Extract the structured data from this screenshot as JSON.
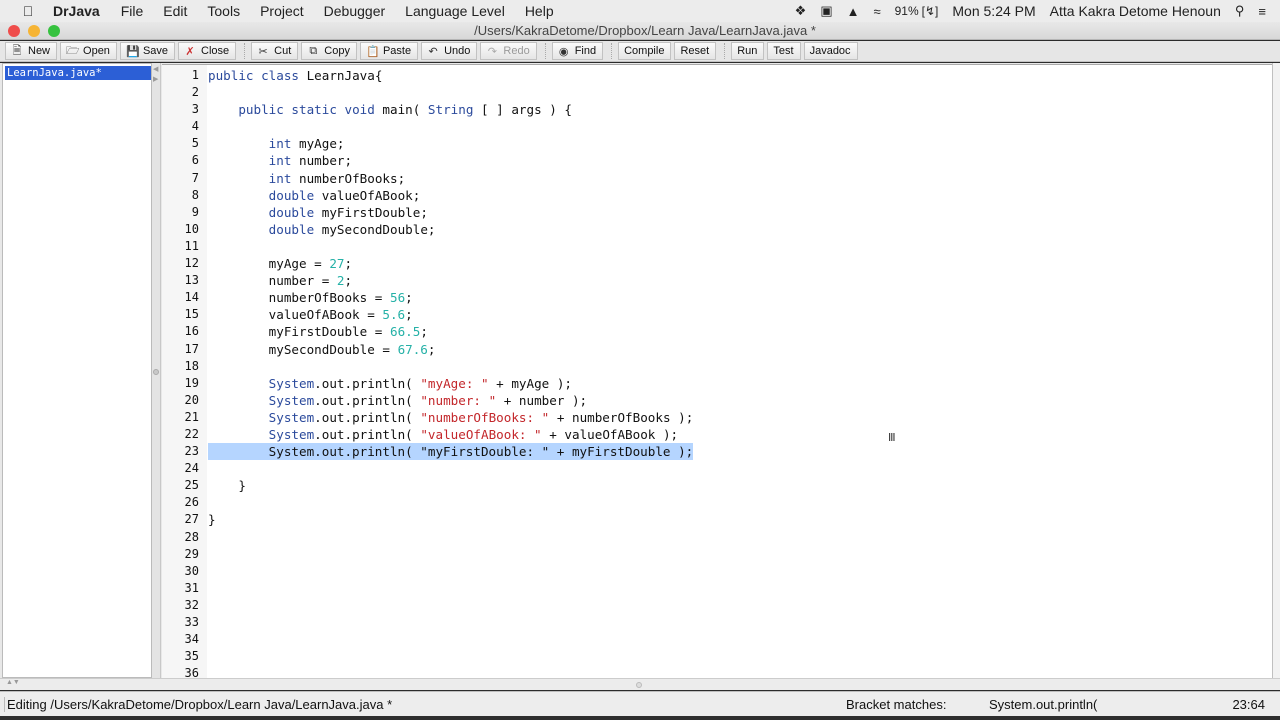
{
  "menubar": {
    "app_name": "DrJava",
    "menus": [
      "File",
      "Edit",
      "Tools",
      "Project",
      "Debugger",
      "Language Level",
      "Help"
    ],
    "status": {
      "battery": "91%",
      "clock": "Mon 5:24 PM",
      "user": "Atta Kakra Detome Henoun"
    }
  },
  "window": {
    "title": "/Users/KakraDetome/Dropbox/Learn Java/LearnJava.java *"
  },
  "toolbar": {
    "buttons": [
      {
        "label": "New",
        "icon": "new-file-icon"
      },
      {
        "label": "Open",
        "icon": "folder-icon"
      },
      {
        "label": "Save",
        "icon": "floppy-icon"
      },
      {
        "label": "Close",
        "icon": "close-file-icon"
      },
      {
        "label": "Cut",
        "icon": "scissors-icon"
      },
      {
        "label": "Copy",
        "icon": "copy-icon"
      },
      {
        "label": "Paste",
        "icon": "clipboard-icon"
      },
      {
        "label": "Undo",
        "icon": "undo-icon"
      },
      {
        "label": "Redo",
        "icon": "redo-icon",
        "disabled": true
      },
      {
        "label": "Find",
        "icon": "binoculars-icon"
      },
      {
        "label": "Compile"
      },
      {
        "label": "Reset"
      },
      {
        "label": "Run"
      },
      {
        "label": "Test"
      },
      {
        "label": "Javadoc"
      }
    ]
  },
  "sidebar": {
    "files": [
      {
        "name": "LearnJava.java*",
        "selected": true
      }
    ]
  },
  "editor": {
    "selected_line": 23,
    "lines": [
      [
        {
          "t": "kw",
          "v": "public class "
        },
        {
          "t": "",
          "v": "LearnJava{"
        }
      ],
      [],
      [
        {
          "t": "",
          "v": "    "
        },
        {
          "t": "kw",
          "v": "public static void "
        },
        {
          "t": "",
          "v": "main( "
        },
        {
          "t": "kw",
          "v": "String"
        },
        {
          "t": "",
          "v": " [ ] args ) {"
        }
      ],
      [],
      [
        {
          "t": "",
          "v": "        "
        },
        {
          "t": "kw",
          "v": "int"
        },
        {
          "t": "",
          "v": " myAge;"
        }
      ],
      [
        {
          "t": "",
          "v": "        "
        },
        {
          "t": "kw",
          "v": "int"
        },
        {
          "t": "",
          "v": " number;"
        }
      ],
      [
        {
          "t": "",
          "v": "        "
        },
        {
          "t": "kw",
          "v": "int"
        },
        {
          "t": "",
          "v": " numberOfBooks;"
        }
      ],
      [
        {
          "t": "",
          "v": "        "
        },
        {
          "t": "kw",
          "v": "double"
        },
        {
          "t": "",
          "v": " valueOfABook;"
        }
      ],
      [
        {
          "t": "",
          "v": "        "
        },
        {
          "t": "kw",
          "v": "double"
        },
        {
          "t": "",
          "v": " myFirstDouble;"
        }
      ],
      [
        {
          "t": "",
          "v": "        "
        },
        {
          "t": "kw",
          "v": "double"
        },
        {
          "t": "",
          "v": " mySecondDouble;"
        }
      ],
      [],
      [
        {
          "t": "",
          "v": "        myAge = "
        },
        {
          "t": "num",
          "v": "27"
        },
        {
          "t": "",
          "v": ";"
        }
      ],
      [
        {
          "t": "",
          "v": "        number = "
        },
        {
          "t": "num",
          "v": "2"
        },
        {
          "t": "",
          "v": ";"
        }
      ],
      [
        {
          "t": "",
          "v": "        numberOfBooks = "
        },
        {
          "t": "num",
          "v": "56"
        },
        {
          "t": "",
          "v": ";"
        }
      ],
      [
        {
          "t": "",
          "v": "        valueOfABook = "
        },
        {
          "t": "num",
          "v": "5.6"
        },
        {
          "t": "",
          "v": ";"
        }
      ],
      [
        {
          "t": "",
          "v": "        myFirstDouble = "
        },
        {
          "t": "num",
          "v": "66.5"
        },
        {
          "t": "",
          "v": ";"
        }
      ],
      [
        {
          "t": "",
          "v": "        mySecondDouble = "
        },
        {
          "t": "num",
          "v": "67.6"
        },
        {
          "t": "",
          "v": ";"
        }
      ],
      [],
      [
        {
          "t": "",
          "v": "        "
        },
        {
          "t": "kw",
          "v": "System"
        },
        {
          "t": "",
          "v": ".out.println( "
        },
        {
          "t": "str",
          "v": "\"myAge: \""
        },
        {
          "t": "",
          "v": " + myAge );"
        }
      ],
      [
        {
          "t": "",
          "v": "        "
        },
        {
          "t": "kw",
          "v": "System"
        },
        {
          "t": "",
          "v": ".out.println( "
        },
        {
          "t": "str",
          "v": "\"number: \""
        },
        {
          "t": "",
          "v": " + number );"
        }
      ],
      [
        {
          "t": "",
          "v": "        "
        },
        {
          "t": "kw",
          "v": "System"
        },
        {
          "t": "",
          "v": ".out.println( "
        },
        {
          "t": "str",
          "v": "\"numberOfBooks: \""
        },
        {
          "t": "",
          "v": " + numberOfBooks );"
        }
      ],
      [
        {
          "t": "",
          "v": "        "
        },
        {
          "t": "kw",
          "v": "System"
        },
        {
          "t": "",
          "v": ".out.println( "
        },
        {
          "t": "str",
          "v": "\"valueOfABook: \""
        },
        {
          "t": "",
          "v": " + valueOfABook );"
        }
      ],
      [
        {
          "t": "",
          "v": "        System.out.println( \"myFirstDouble: \" + myFirstDouble );"
        }
      ],
      [],
      [
        {
          "t": "",
          "v": "    }"
        }
      ],
      [],
      [
        {
          "t": "",
          "v": "}"
        }
      ],
      [],
      [],
      [],
      [],
      [],
      [],
      [],
      [],
      []
    ]
  },
  "statusbar": {
    "editing": "Editing /Users/KakraDetome/Dropbox/Learn Java/LearnJava.java *",
    "bracket_label": "Bracket matches:",
    "bracket_value": "System.out.println(",
    "position": "23:64"
  }
}
